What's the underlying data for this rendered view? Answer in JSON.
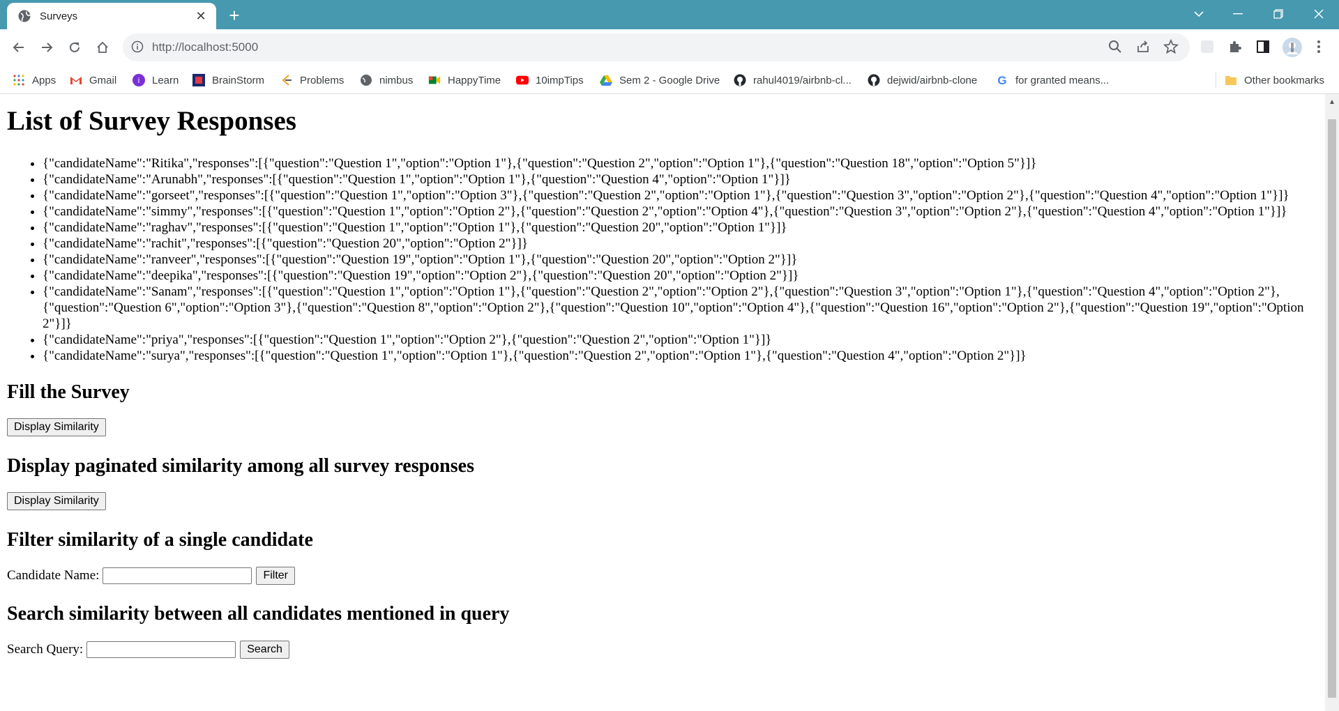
{
  "browser": {
    "tab_title": "Surveys",
    "url": "http://localhost:5000",
    "bookmarks": [
      {
        "label": "Apps",
        "icon": "apps-grid-icon"
      },
      {
        "label": "Gmail",
        "icon": "gmail-icon"
      },
      {
        "label": "Learn",
        "icon": "learn-icon"
      },
      {
        "label": "BrainStorm",
        "icon": "brainstorm-icon"
      },
      {
        "label": "Problems",
        "icon": "problems-icon"
      },
      {
        "label": "nimbus",
        "icon": "globe-icon"
      },
      {
        "label": "HappyTime",
        "icon": "meet-icon"
      },
      {
        "label": "10impTips",
        "icon": "youtube-icon"
      },
      {
        "label": "Sem 2 - Google Drive",
        "icon": "drive-icon"
      },
      {
        "label": "rahul4019/airbnb-cl...",
        "icon": "github-icon"
      },
      {
        "label": "dejwid/airbnb-clone",
        "icon": "github-icon"
      },
      {
        "label": "for granted means...",
        "icon": "google-icon"
      }
    ],
    "other_bookmarks": "Other bookmarks"
  },
  "page": {
    "title": "List of Survey Responses",
    "responses": [
      "{\"candidateName\":\"Ritika\",\"responses\":[{\"question\":\"Question 1\",\"option\":\"Option 1\"},{\"question\":\"Question 2\",\"option\":\"Option 1\"},{\"question\":\"Question 18\",\"option\":\"Option 5\"}]}",
      "{\"candidateName\":\"Arunabh\",\"responses\":[{\"question\":\"Question 1\",\"option\":\"Option 1\"},{\"question\":\"Question 4\",\"option\":\"Option 1\"}]}",
      "{\"candidateName\":\"gorseet\",\"responses\":[{\"question\":\"Question 1\",\"option\":\"Option 3\"},{\"question\":\"Question 2\",\"option\":\"Option 1\"},{\"question\":\"Question 3\",\"option\":\"Option 2\"},{\"question\":\"Question 4\",\"option\":\"Option 1\"}]}",
      "{\"candidateName\":\"simmy\",\"responses\":[{\"question\":\"Question 1\",\"option\":\"Option 2\"},{\"question\":\"Question 2\",\"option\":\"Option 4\"},{\"question\":\"Question 3\",\"option\":\"Option 2\"},{\"question\":\"Question 4\",\"option\":\"Option 1\"}]}",
      "{\"candidateName\":\"raghav\",\"responses\":[{\"question\":\"Question 1\",\"option\":\"Option 1\"},{\"question\":\"Question 20\",\"option\":\"Option 1\"}]}",
      "{\"candidateName\":\"rachit\",\"responses\":[{\"question\":\"Question 20\",\"option\":\"Option 2\"}]}",
      "{\"candidateName\":\"ranveer\",\"responses\":[{\"question\":\"Question 19\",\"option\":\"Option 1\"},{\"question\":\"Question 20\",\"option\":\"Option 2\"}]}",
      "{\"candidateName\":\"deepika\",\"responses\":[{\"question\":\"Question 19\",\"option\":\"Option 2\"},{\"question\":\"Question 20\",\"option\":\"Option 2\"}]}",
      "{\"candidateName\":\"Sanam\",\"responses\":[{\"question\":\"Question 1\",\"option\":\"Option 1\"},{\"question\":\"Question 2\",\"option\":\"Option 2\"},{\"question\":\"Question 3\",\"option\":\"Option 1\"},{\"question\":\"Question 4\",\"option\":\"Option 2\"},{\"question\":\"Question 6\",\"option\":\"Option 3\"},{\"question\":\"Question 8\",\"option\":\"Option 2\"},{\"question\":\"Question 10\",\"option\":\"Option 4\"},{\"question\":\"Question 16\",\"option\":\"Option 2\"},{\"question\":\"Question 19\",\"option\":\"Option 2\"}]}",
      "{\"candidateName\":\"priya\",\"responses\":[{\"question\":\"Question 1\",\"option\":\"Option 2\"},{\"question\":\"Question 2\",\"option\":\"Option 1\"}]}",
      "{\"candidateName\":\"surya\",\"responses\":[{\"question\":\"Question 1\",\"option\":\"Option 1\"},{\"question\":\"Question 2\",\"option\":\"Option 1\"},{\"question\":\"Question 4\",\"option\":\"Option 2\"}]}"
    ],
    "fill_heading": "Fill the Survey",
    "fill_button": "Display Similarity",
    "paginated_heading": "Display paginated similarity among all survey responses",
    "paginated_button": "Display Similarity",
    "filter_heading": "Filter similarity of a single candidate",
    "candidate_label": "Candidate Name:",
    "candidate_value": "",
    "filter_button": "Filter",
    "search_heading": "Search similarity between all candidates mentioned in query",
    "search_label": "Search Query:",
    "search_value": "",
    "search_button": "Search"
  }
}
